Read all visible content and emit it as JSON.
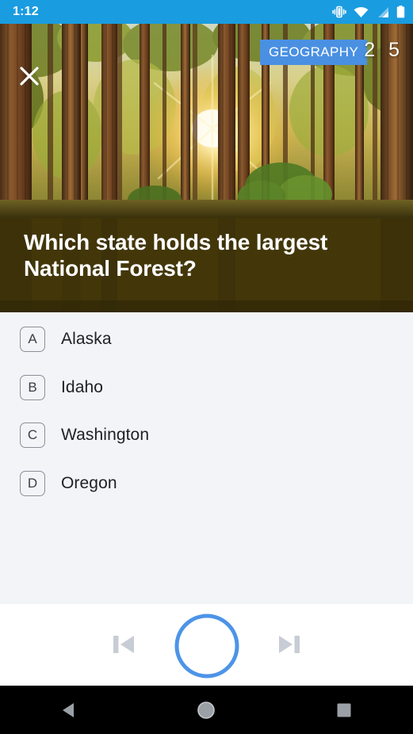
{
  "statusbar": {
    "time": "1:12",
    "icons": [
      "vibrate-icon",
      "wifi-icon",
      "cellular-signal-icon",
      "battery-icon"
    ]
  },
  "hero": {
    "close_icon": "close-icon",
    "image_alt": "forest-sunrise-photo",
    "category": "GEOGRAPHY",
    "timer": "2 5"
  },
  "question": {
    "text": "Which state holds the largest National Forest?"
  },
  "answers": [
    {
      "letter": "A",
      "label": "Alaska"
    },
    {
      "letter": "B",
      "label": "Idaho"
    },
    {
      "letter": "C",
      "label": "Washington"
    },
    {
      "letter": "D",
      "label": "Oregon"
    }
  ],
  "player": {
    "previous_icon": "skip-previous-icon",
    "record_icon": "record-circle-icon",
    "next_icon": "skip-next-icon"
  },
  "navbar": {
    "back_icon": "back-triangle-icon",
    "home_icon": "home-circle-icon",
    "recents_icon": "recents-square-icon"
  },
  "colors": {
    "status_bar": "#1a9ce0",
    "accent_blue": "#4a90e2",
    "question_panel": "#3b3107",
    "answer_area": "#f2f4f8",
    "player_icon_gray": "#c8ccd4"
  }
}
